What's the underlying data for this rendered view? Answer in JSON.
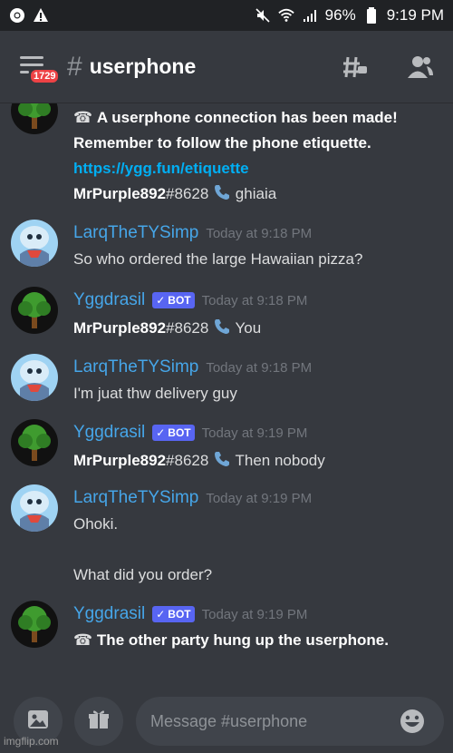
{
  "status_bar": {
    "battery": "96%",
    "time": "9:19 PM"
  },
  "header": {
    "channel_name": "userphone",
    "badge_count": "1729"
  },
  "messages": [
    {
      "lines": [
        {
          "emoji": "☎",
          "text": "A userphone connection has been made!"
        },
        {
          "text": "Remember to follow the phone etiquette."
        },
        {
          "link": "https://ygg.fun/etiquette"
        },
        {
          "user": "MrPurple892",
          "tag": "#8628",
          "reply": "ghiaia"
        }
      ]
    },
    {
      "author": "LarqTheTYSimp",
      "timestamp": "Today at 9:18 PM",
      "text": "So who ordered the large Hawaiian pizza?"
    },
    {
      "author": "Yggdrasil",
      "bot_label": "BOT",
      "timestamp": "Today at 9:18 PM",
      "user": "MrPurple892",
      "tag": "#8628",
      "reply": "You"
    },
    {
      "author": "LarqTheTYSimp",
      "timestamp": "Today at 9:18 PM",
      "text": "I'm juat thw delivery guy"
    },
    {
      "author": "Yggdrasil",
      "bot_label": "BOT",
      "timestamp": "Today at 9:19 PM",
      "user": "MrPurple892",
      "tag": "#8628",
      "reply": "Then nobody"
    },
    {
      "author": "LarqTheTYSimp",
      "timestamp": "Today at 9:19 PM",
      "text": "Ohoki.",
      "text2": "What did you order?"
    },
    {
      "author": "Yggdrasil",
      "bot_label": "BOT",
      "timestamp": "Today at 9:19 PM",
      "emoji": "☎",
      "text": "The other party hung up the userphone."
    }
  ],
  "composer": {
    "placeholder": "Message #userphone"
  },
  "watermark": "imgflip.com",
  "colors": {
    "background": "#36393f",
    "author": "#46a6e9",
    "link": "#00aff4",
    "bot_tag": "#5865f2"
  }
}
